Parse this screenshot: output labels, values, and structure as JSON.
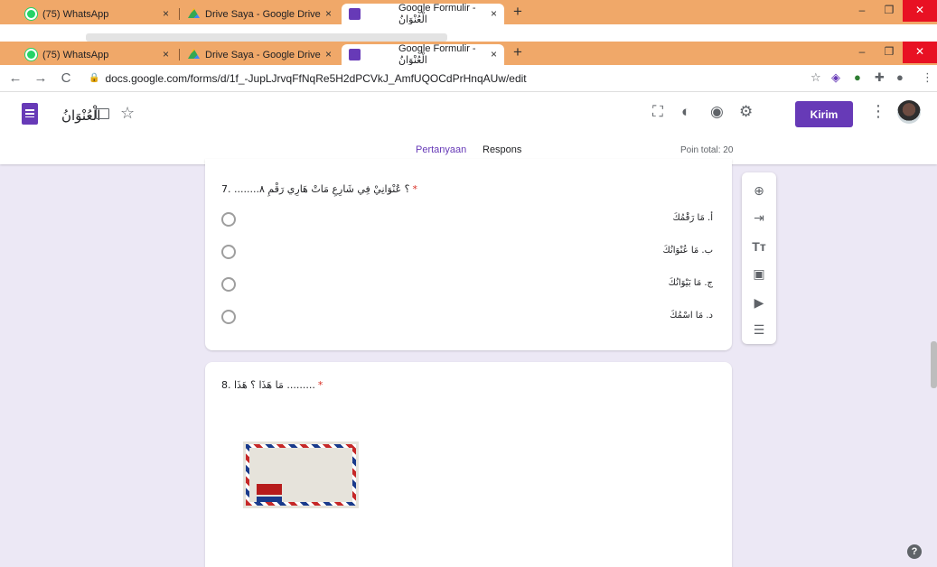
{
  "browser": {
    "tabs": [
      {
        "title": "(75) WhatsApp",
        "close": "×"
      },
      {
        "title": "Drive Saya - Google Drive",
        "close": "×"
      },
      {
        "title": "Google Formulir - الْعُنْوَانُ",
        "close": "×"
      }
    ],
    "new_tab": "+",
    "window_controls": {
      "minimize": "–",
      "restore": "❐",
      "close": "✕"
    },
    "nav": {
      "back": "←",
      "forward": "→",
      "reload": "C"
    },
    "url": "docs.google.com/forms/d/1f_-JupLJrvqFfNqRe5H2dPCVkJ_AmfUQOCdPrHnqAUw/edit",
    "accent_color": "#f0a869"
  },
  "header": {
    "doc_title": "الْعُنْوَانُ",
    "send_label": "Kirim",
    "tabs": {
      "questions": "Pertanyaan",
      "responses": "Respons"
    },
    "points": "Poin total: 20",
    "accent_color": "#673ab7"
  },
  "questions": [
    {
      "text": "7. ........؟ عُنْوَانِيْ فِي شَارِعِ مَاتْ هَارِي رَقْمِ ٨",
      "required": "*",
      "options": [
        "أ. مَا رَقْمُكَ",
        "ب. مَا عُنْوَانُكَ",
        "ج. مَا بَيْوَانُكَ",
        "د. مَا اسْمُكَ"
      ]
    },
    {
      "text": "8. مَا هَذَا ؟ هَذَا .........",
      "required": "*",
      "image": "envelope"
    }
  ],
  "side_tools": [
    "add-question-icon",
    "import-icon",
    "title-icon",
    "image-icon",
    "video-icon",
    "section-icon"
  ],
  "help": "?"
}
